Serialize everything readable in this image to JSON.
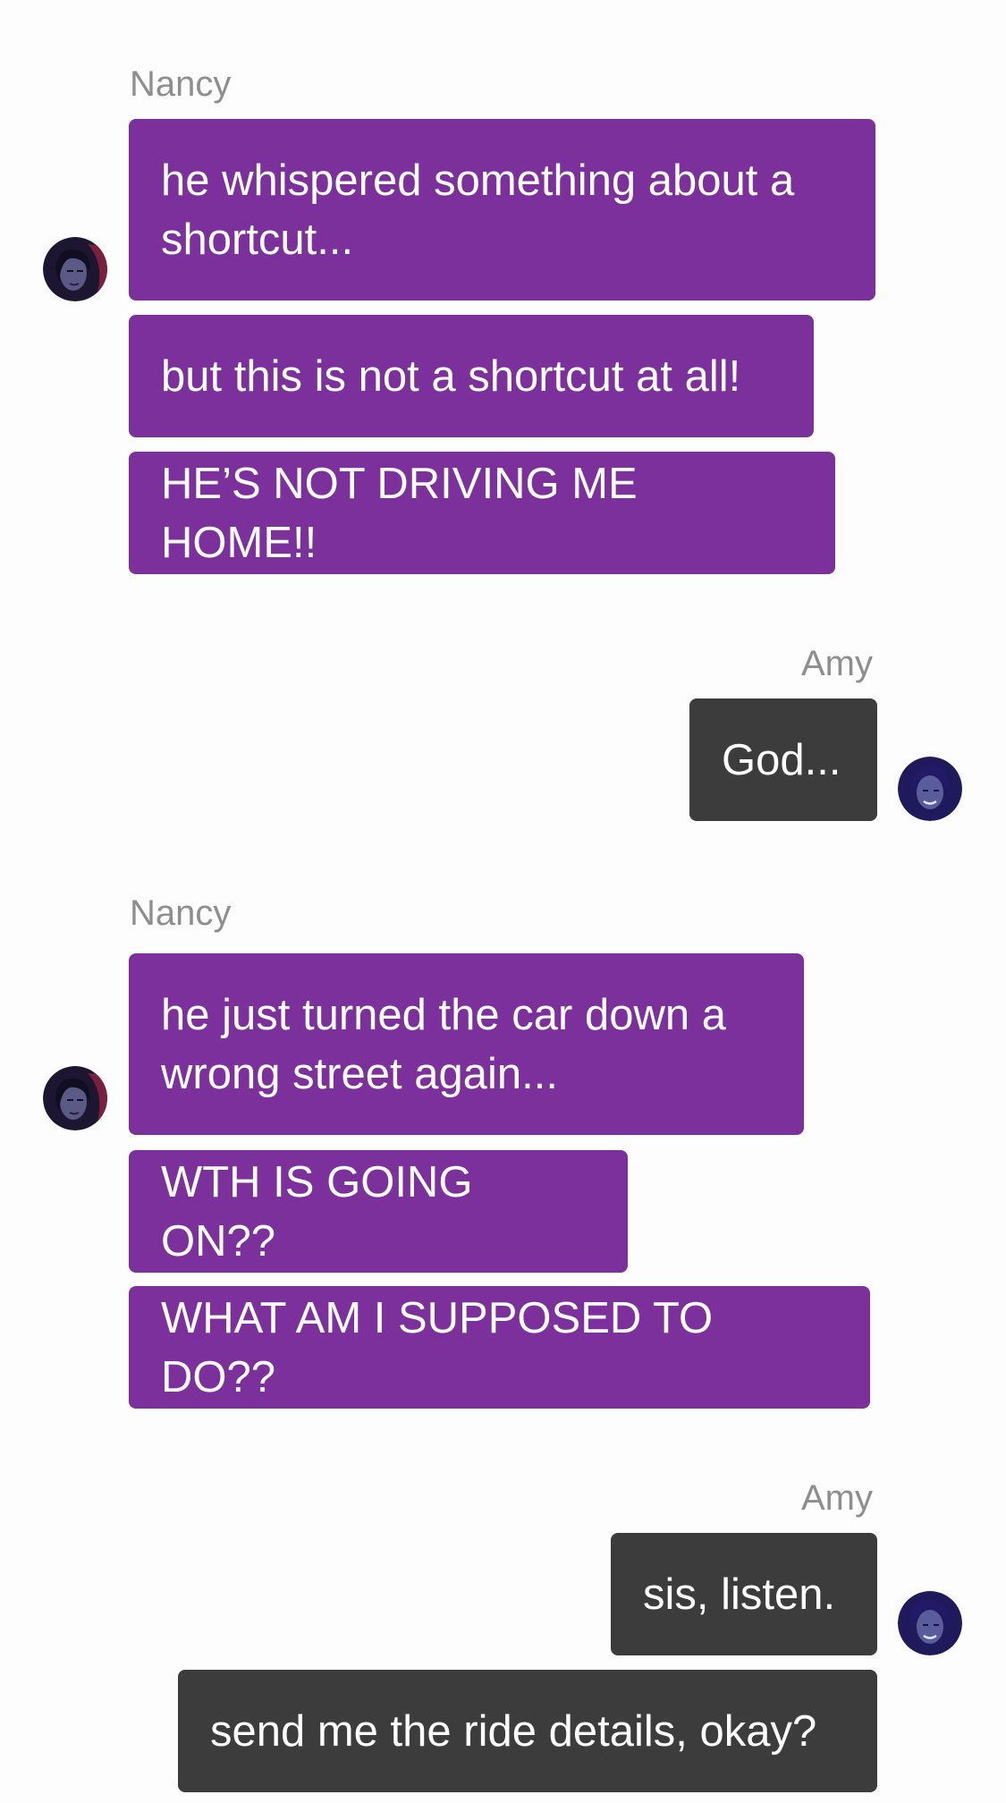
{
  "colors": {
    "incoming_bubble": "#7b309c",
    "outgoing_bubble": "#3c3c3c",
    "sender_name": "#8e8e8e",
    "background": "#fdfdfd"
  },
  "messages": [
    {
      "sender": "Nancy",
      "avatar_icon": "nancy-avatar-icon",
      "bubbles": [
        "he whispered something about a\nshortcut...",
        "but this is not a shortcut at all!",
        "HE’S NOT DRIVING ME HOME!!"
      ]
    },
    {
      "sender": "Amy",
      "avatar_icon": "amy-avatar-icon",
      "bubbles": [
        "God..."
      ]
    },
    {
      "sender": "Nancy",
      "avatar_icon": "nancy-avatar-icon",
      "bubbles": [
        "he just turned the car down a\nwrong street again...",
        "WTH IS GOING ON??",
        "WHAT AM I SUPPOSED TO DO??"
      ]
    },
    {
      "sender": "Amy",
      "avatar_icon": "amy-avatar-icon",
      "bubbles": [
        "sis, listen.",
        "send me the ride details, okay?"
      ]
    }
  ]
}
